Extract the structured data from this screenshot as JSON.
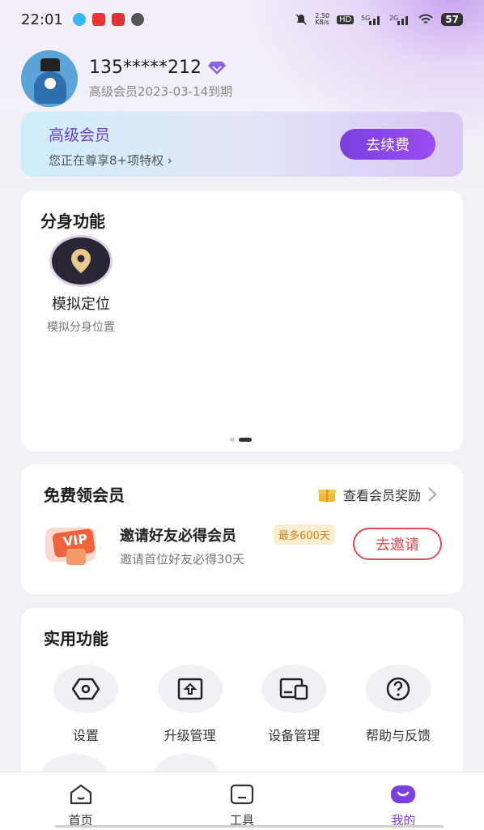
{
  "status": {
    "time": "22:01",
    "speed": "2.50\nKB/s",
    "battery": "57"
  },
  "profile": {
    "phone": "135*****212",
    "expiry": "高级会员2023-03-14到期"
  },
  "vip_card": {
    "title": "高级会员",
    "subtitle": "您正在尊享8+项特权 ›",
    "button": "去续费"
  },
  "clone": {
    "title": "分身功能",
    "item_label": "模拟定位",
    "item_sub": "模拟分身位置"
  },
  "free_vip": {
    "title": "免费领会员",
    "link": "查看会员奖励",
    "invite_title": "邀请好友必得会员",
    "badge": "最多600天",
    "invite_sub": "邀请首位好友必得30天",
    "invite_button": "去邀请",
    "vip_tag": "VIP"
  },
  "tools": {
    "title": "实用功能",
    "items": [
      {
        "label": "设置"
      },
      {
        "label": "升级管理"
      },
      {
        "label": "设备管理"
      },
      {
        "label": "帮助与反馈"
      }
    ]
  },
  "tabbar": {
    "items": [
      {
        "label": "首页"
      },
      {
        "label": "工具"
      },
      {
        "label": "我的"
      }
    ]
  },
  "colors": {
    "accent": "#7c3fe0",
    "invite": "#e24b54"
  }
}
